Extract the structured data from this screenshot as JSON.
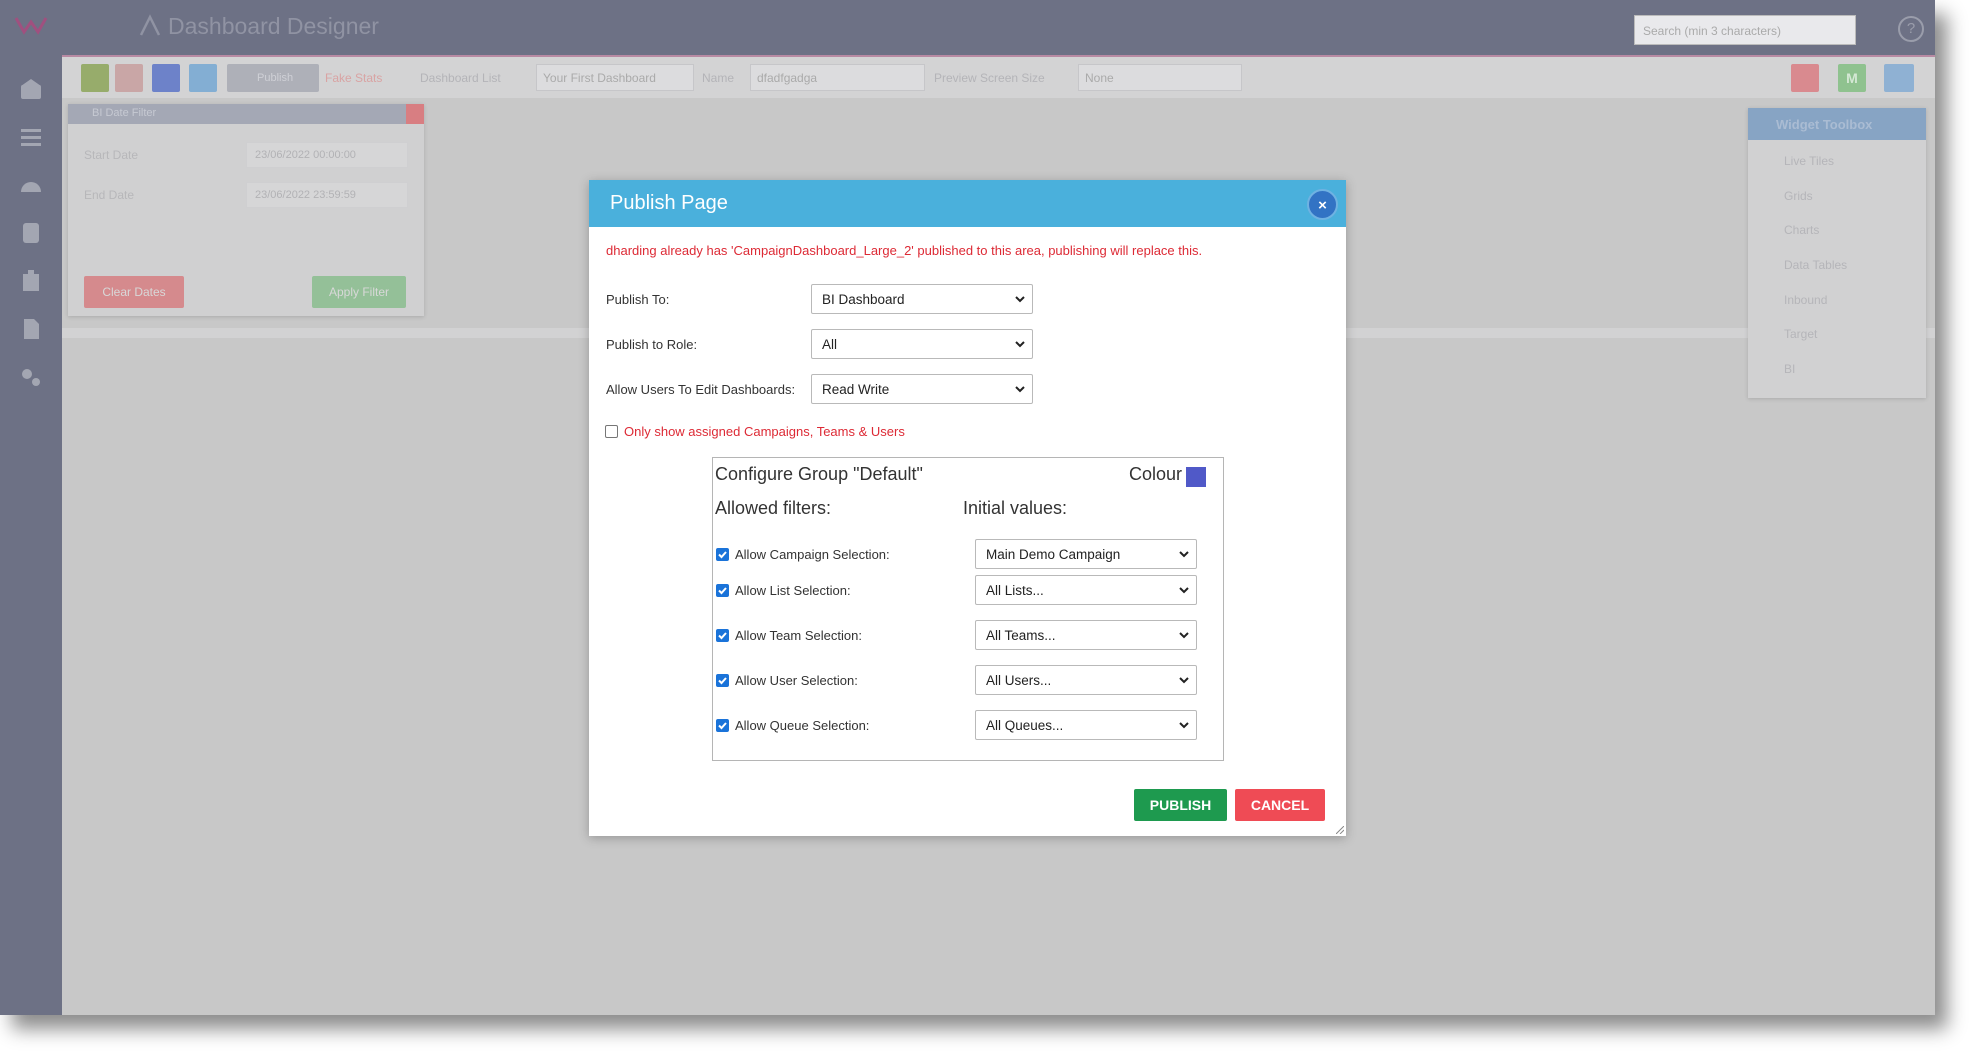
{
  "app": {
    "title": "Dashboard Designer",
    "search_placeholder": "Search (min 3 characters)",
    "help_glyph": "?"
  },
  "toolbar": {
    "fake_stats_label": "Fake Stats",
    "publish_label": "Publish",
    "dashboard_list_label": "Dashboard List",
    "dashboard_list_value": "Your First Dashboard",
    "name_label": "Name",
    "name_value": "dfadfgadga",
    "preview_label": "Preview Screen Size",
    "preview_value": "None",
    "btn_m_label": "M"
  },
  "filter_widget": {
    "title": "BI Date Filter",
    "start_label": "Start Date",
    "start_value": "23/06/2022 00:00:00",
    "end_label": "End Date",
    "end_value": "23/06/2022 23:59:59",
    "clear_label": "Clear Dates",
    "apply_label": "Apply Filter"
  },
  "toolbox": {
    "title": "Widget Toolbox",
    "items": [
      "Live Tiles",
      "Grids",
      "Charts",
      "Data Tables",
      "Inbound",
      "Target",
      "BI"
    ]
  },
  "modal": {
    "title": "Publish Page",
    "close_glyph": "×",
    "warning": "dharding already has 'CampaignDashboard_Large_2' published to this area, publishing will replace this.",
    "publish_to_label": "Publish To:",
    "publish_to_value": "BI Dashboard",
    "publish_role_label": "Publish to Role:",
    "publish_role_value": "All",
    "allow_edit_label": "Allow Users To Edit Dashboards:",
    "allow_edit_value": "Read Write",
    "only_show_label": "Only show assigned Campaigns, Teams & Users",
    "only_show_checked": false,
    "group": {
      "title": "Configure Group \"Default\"",
      "colour_label": "Colour",
      "colour_value": "#5059c8",
      "allowed_header": "Allowed filters:",
      "initial_header": "Initial values:",
      "rows": [
        {
          "label": "Allow Campaign Selection:",
          "checked": true,
          "value": "Main Demo Campaign"
        },
        {
          "label": "Allow List Selection:",
          "checked": true,
          "value": "All Lists..."
        },
        {
          "label": "Allow Team Selection:",
          "checked": true,
          "value": "All Teams..."
        },
        {
          "label": "Allow User Selection:",
          "checked": true,
          "value": "All Users..."
        },
        {
          "label": "Allow Queue Selection:",
          "checked": true,
          "value": "All Queues..."
        }
      ]
    },
    "publish_label": "PUBLISH",
    "cancel_label": "CANCEL"
  },
  "colors": {
    "modal_header": "#4ab0dc",
    "publish": "#1e9a4f",
    "cancel": "#ef4b55",
    "warning": "#dd2a35"
  }
}
